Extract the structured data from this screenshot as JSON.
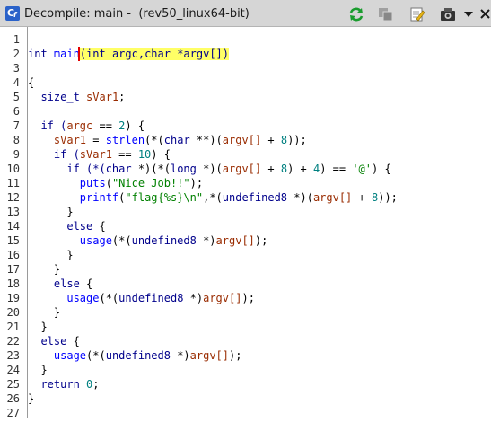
{
  "window": {
    "title": "Decompile: main -  (rev50_linux64-bit)",
    "icon_name": "decompiler-icon",
    "icon_c": "C",
    "icon_f": "f"
  },
  "toolbar": {
    "buttons": [
      {
        "name": "refresh-icon"
      },
      {
        "name": "copy-icon"
      },
      {
        "name": "edit-icon"
      },
      {
        "name": "snapshot-icon"
      },
      {
        "name": "chevron-down-icon"
      },
      {
        "name": "close-icon"
      }
    ]
  },
  "colors": {
    "keyword": "#00008b",
    "function": "#0000ff",
    "variable": "#992b00",
    "string": "#008000",
    "number": "#008080",
    "plain": "#000000",
    "highlight": "#ffff66",
    "cursor": "#e30000"
  },
  "code": {
    "lines": [
      {
        "n": "1",
        "tokens": []
      },
      {
        "n": "2",
        "tokens": [
          {
            "t": "int",
            "c": "keyword"
          },
          {
            "t": " ",
            "c": "plain"
          },
          {
            "t": "main",
            "c": "function"
          },
          {
            "t": "(int argc,char *argv[])",
            "c": "keyword",
            "hl": true
          }
        ]
      },
      {
        "n": "3",
        "tokens": []
      },
      {
        "n": "4",
        "tokens": [
          {
            "t": "{",
            "c": "plain"
          }
        ]
      },
      {
        "n": "5",
        "tokens": [
          {
            "t": "  ",
            "c": "plain"
          },
          {
            "t": "size_t",
            "c": "keyword"
          },
          {
            "t": " ",
            "c": "plain"
          },
          {
            "t": "sVar1",
            "c": "variable"
          },
          {
            "t": ";",
            "c": "plain"
          }
        ]
      },
      {
        "n": "6",
        "tokens": []
      },
      {
        "n": "7",
        "tokens": [
          {
            "t": "  if (",
            "c": "keyword"
          },
          {
            "t": "argc",
            "c": "variable"
          },
          {
            "t": " == ",
            "c": "plain"
          },
          {
            "t": "2",
            "c": "number"
          },
          {
            "t": ") {",
            "c": "plain"
          }
        ]
      },
      {
        "n": "8",
        "tokens": [
          {
            "t": "    ",
            "c": "plain"
          },
          {
            "t": "sVar1",
            "c": "variable"
          },
          {
            "t": " = ",
            "c": "plain"
          },
          {
            "t": "strlen",
            "c": "function"
          },
          {
            "t": "(*(",
            "c": "plain"
          },
          {
            "t": "char",
            "c": "keyword"
          },
          {
            "t": " **)(",
            "c": "plain"
          },
          {
            "t": "argv[]",
            "c": "variable"
          },
          {
            "t": " + ",
            "c": "plain"
          },
          {
            "t": "8",
            "c": "number"
          },
          {
            "t": "));",
            "c": "plain"
          }
        ]
      },
      {
        "n": "9",
        "tokens": [
          {
            "t": "    if (",
            "c": "keyword"
          },
          {
            "t": "sVar1",
            "c": "variable"
          },
          {
            "t": " == ",
            "c": "plain"
          },
          {
            "t": "10",
            "c": "number"
          },
          {
            "t": ") {",
            "c": "plain"
          }
        ]
      },
      {
        "n": "10",
        "tokens": [
          {
            "t": "      if (*(",
            "c": "keyword"
          },
          {
            "t": "char",
            "c": "keyword"
          },
          {
            "t": " *)(*(",
            "c": "plain"
          },
          {
            "t": "long",
            "c": "keyword"
          },
          {
            "t": " *)(",
            "c": "plain"
          },
          {
            "t": "argv[]",
            "c": "variable"
          },
          {
            "t": " + ",
            "c": "plain"
          },
          {
            "t": "8",
            "c": "number"
          },
          {
            "t": ") + ",
            "c": "plain"
          },
          {
            "t": "4",
            "c": "number"
          },
          {
            "t": ") == ",
            "c": "plain"
          },
          {
            "t": "'@'",
            "c": "string"
          },
          {
            "t": ") {",
            "c": "plain"
          }
        ]
      },
      {
        "n": "11",
        "tokens": [
          {
            "t": "        ",
            "c": "plain"
          },
          {
            "t": "puts",
            "c": "function"
          },
          {
            "t": "(",
            "c": "plain"
          },
          {
            "t": "\"Nice Job!!\"",
            "c": "string"
          },
          {
            "t": ");",
            "c": "plain"
          }
        ]
      },
      {
        "n": "12",
        "tokens": [
          {
            "t": "        ",
            "c": "plain"
          },
          {
            "t": "printf",
            "c": "function"
          },
          {
            "t": "(",
            "c": "plain"
          },
          {
            "t": "\"flag{%s}\\n\"",
            "c": "string"
          },
          {
            "t": ",*(",
            "c": "plain"
          },
          {
            "t": "undefined8",
            "c": "keyword"
          },
          {
            "t": " *)(",
            "c": "plain"
          },
          {
            "t": "argv[]",
            "c": "variable"
          },
          {
            "t": " + ",
            "c": "plain"
          },
          {
            "t": "8",
            "c": "number"
          },
          {
            "t": "));",
            "c": "plain"
          }
        ]
      },
      {
        "n": "13",
        "tokens": [
          {
            "t": "      }",
            "c": "plain"
          }
        ]
      },
      {
        "n": "14",
        "tokens": [
          {
            "t": "      else",
            "c": "keyword"
          },
          {
            "t": " {",
            "c": "plain"
          }
        ]
      },
      {
        "n": "15",
        "tokens": [
          {
            "t": "        ",
            "c": "plain"
          },
          {
            "t": "usage",
            "c": "function"
          },
          {
            "t": "(*(",
            "c": "plain"
          },
          {
            "t": "undefined8",
            "c": "keyword"
          },
          {
            "t": " *)",
            "c": "plain"
          },
          {
            "t": "argv[]",
            "c": "variable"
          },
          {
            "t": ");",
            "c": "plain"
          }
        ]
      },
      {
        "n": "16",
        "tokens": [
          {
            "t": "      }",
            "c": "plain"
          }
        ]
      },
      {
        "n": "17",
        "tokens": [
          {
            "t": "    }",
            "c": "plain"
          }
        ]
      },
      {
        "n": "18",
        "tokens": [
          {
            "t": "    else",
            "c": "keyword"
          },
          {
            "t": " {",
            "c": "plain"
          }
        ]
      },
      {
        "n": "19",
        "tokens": [
          {
            "t": "      ",
            "c": "plain"
          },
          {
            "t": "usage",
            "c": "function"
          },
          {
            "t": "(*(",
            "c": "plain"
          },
          {
            "t": "undefined8",
            "c": "keyword"
          },
          {
            "t": " *)",
            "c": "plain"
          },
          {
            "t": "argv[]",
            "c": "variable"
          },
          {
            "t": ");",
            "c": "plain"
          }
        ]
      },
      {
        "n": "20",
        "tokens": [
          {
            "t": "    }",
            "c": "plain"
          }
        ]
      },
      {
        "n": "21",
        "tokens": [
          {
            "t": "  }",
            "c": "plain"
          }
        ]
      },
      {
        "n": "22",
        "tokens": [
          {
            "t": "  else",
            "c": "keyword"
          },
          {
            "t": " {",
            "c": "plain"
          }
        ]
      },
      {
        "n": "23",
        "tokens": [
          {
            "t": "    ",
            "c": "plain"
          },
          {
            "t": "usage",
            "c": "function"
          },
          {
            "t": "(*(",
            "c": "plain"
          },
          {
            "t": "undefined8",
            "c": "keyword"
          },
          {
            "t": " *)",
            "c": "plain"
          },
          {
            "t": "argv[]",
            "c": "variable"
          },
          {
            "t": ");",
            "c": "plain"
          }
        ]
      },
      {
        "n": "24",
        "tokens": [
          {
            "t": "  }",
            "c": "plain"
          }
        ]
      },
      {
        "n": "25",
        "tokens": [
          {
            "t": "  return",
            "c": "keyword"
          },
          {
            "t": " ",
            "c": "plain"
          },
          {
            "t": "0",
            "c": "number"
          },
          {
            "t": ";",
            "c": "plain"
          }
        ]
      },
      {
        "n": "26",
        "tokens": [
          {
            "t": "}",
            "c": "plain"
          }
        ]
      },
      {
        "n": "27",
        "tokens": []
      }
    ]
  }
}
